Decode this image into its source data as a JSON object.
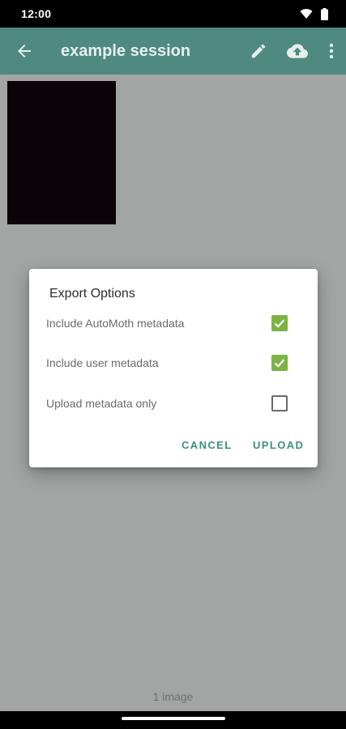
{
  "status_bar": {
    "time": "12:00"
  },
  "app_bar": {
    "title": "example session",
    "actions": [
      "edit-icon",
      "cloud-upload-icon",
      "more-vert-icon"
    ]
  },
  "colors": {
    "app_bar": "#4e8a80",
    "accent": "#3b8f82",
    "checkbox_checked": "#7cb342",
    "scrim_background": "#a3a5a4"
  },
  "dialog": {
    "title": "Export Options",
    "options": [
      {
        "label": "Include AutoMoth metadata",
        "checked": true
      },
      {
        "label": "Include user metadata",
        "checked": true
      },
      {
        "label": "Upload metadata only",
        "checked": false
      }
    ],
    "cancel_label": "CANCEL",
    "upload_label": "UPLOAD"
  },
  "footer": {
    "image_count": "1 image"
  }
}
